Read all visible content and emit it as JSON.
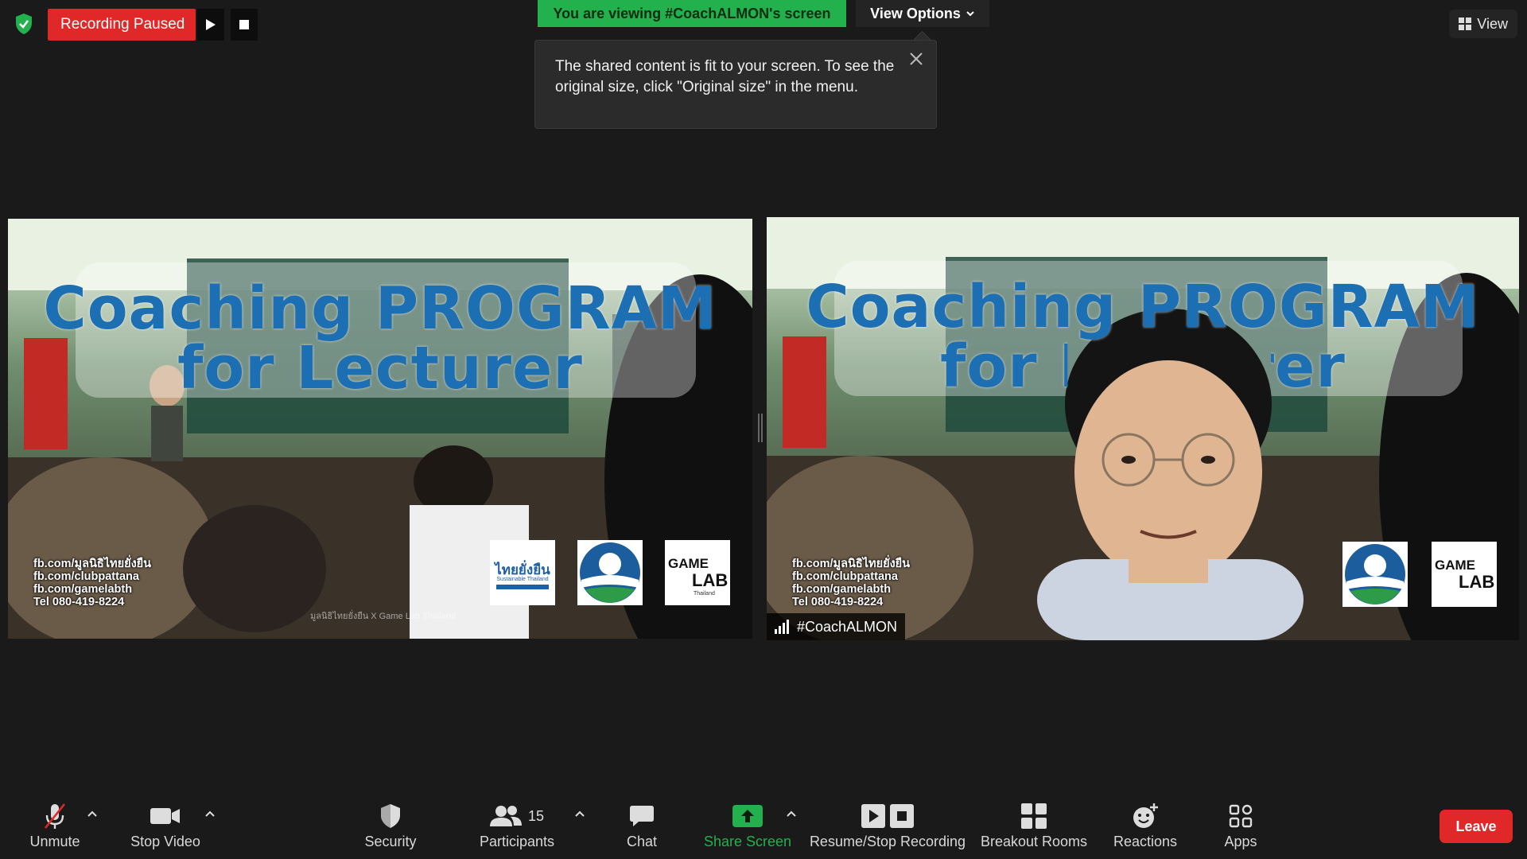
{
  "recording": {
    "status_label": "Recording Paused"
  },
  "banner": {
    "viewing_text": "You are viewing #CoachALMON's screen",
    "view_options_label": "View Options"
  },
  "tooltip": {
    "text": "The shared content is fit to your screen. To see the original size, click \"Original size\" in the menu."
  },
  "top_right": {
    "view_label": "View"
  },
  "slide": {
    "title_line1": "Coaching PROGRAM",
    "title_line2": "for Lecturer",
    "contacts": [
      "fb.com/มูลนิธิไทยยั่งยืน",
      "fb.com/clubpattana",
      "fb.com/gamelabth",
      "Tel 080-419-8224"
    ],
    "credit": "มูลนิธิไทยยั่งยืน X Game Lab Thailand",
    "logo_thai": "ไทยยั่งยืน",
    "logo_thai_sub": "Sustainable Thailand",
    "logo_game": "GAME",
    "logo_lab": "LAB",
    "logo_lab_sub": "Thailand"
  },
  "participant": {
    "name": "#CoachALMON"
  },
  "toolbar": {
    "unmute": "Unmute",
    "stop_video": "Stop Video",
    "security": "Security",
    "participants": "Participants",
    "participants_count": "15",
    "chat": "Chat",
    "share_screen": "Share Screen",
    "resume_stop_recording": "Resume/Stop Recording",
    "breakout_rooms": "Breakout Rooms",
    "reactions": "Reactions",
    "apps": "Apps",
    "leave": "Leave"
  },
  "colors": {
    "recording_red": "#e02828",
    "banner_green": "#23b14d",
    "share_green": "#23b14d",
    "leave_red": "#e02828",
    "toolbar_bg": "#1a1a1a"
  }
}
